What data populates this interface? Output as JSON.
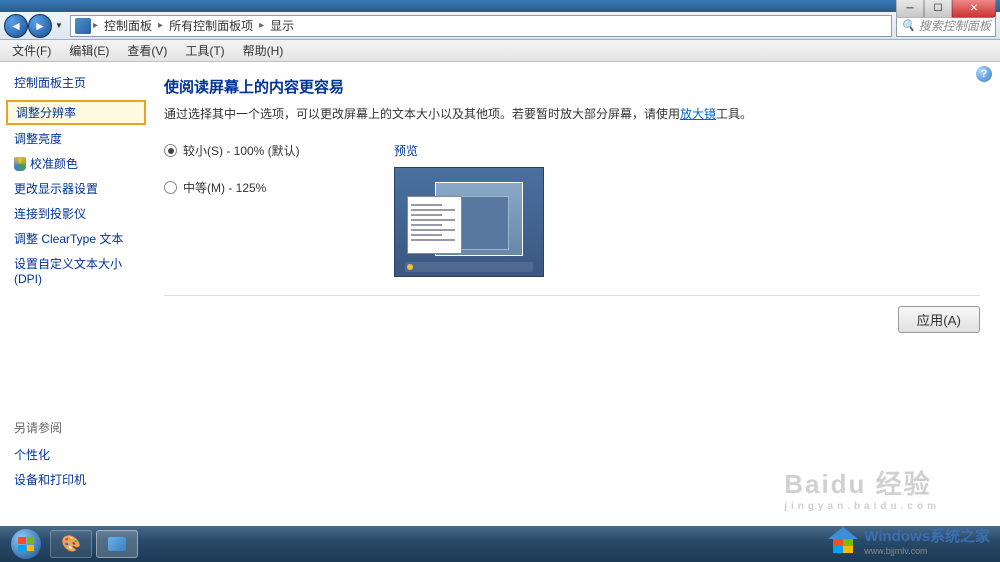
{
  "titlebar": {
    "min_tooltip": "最小化",
    "max_tooltip": "最大化",
    "close_tooltip": "关闭"
  },
  "breadcrumb": {
    "items": [
      "控制面板",
      "所有控制面板项",
      "显示"
    ]
  },
  "search": {
    "placeholder": "搜索控制面板"
  },
  "menubar": {
    "items": [
      "文件(F)",
      "编辑(E)",
      "查看(V)",
      "工具(T)",
      "帮助(H)"
    ]
  },
  "sidebar": {
    "title": "控制面板主页",
    "links": [
      "调整分辨率",
      "调整亮度",
      "校准颜色",
      "更改显示器设置",
      "连接到投影仪",
      "调整 ClearType 文本",
      "设置自定义文本大小(DPI)"
    ],
    "see_also_title": "另请参阅",
    "see_also_links": [
      "个性化",
      "设备和打印机"
    ]
  },
  "content": {
    "title": "使阅读屏幕上的内容更容易",
    "desc_part1": "通过选择其中一个选项，可以更改屏幕上的文本大小以及其他项。若要暂时放大部分屏幕，请使用",
    "magnifier_link": "放大镜",
    "desc_part2": "工具。",
    "option_small": "较小(S) - 100% (默认)",
    "option_medium": "中等(M) - 125%",
    "preview_label": "预览",
    "apply_button": "应用(A)"
  },
  "watermark": {
    "brand": "Baidu 经验",
    "sub": "jingyan.baidu.com",
    "site_name": "Windows系统之家",
    "site_url": "www.bjjmlv.com"
  }
}
